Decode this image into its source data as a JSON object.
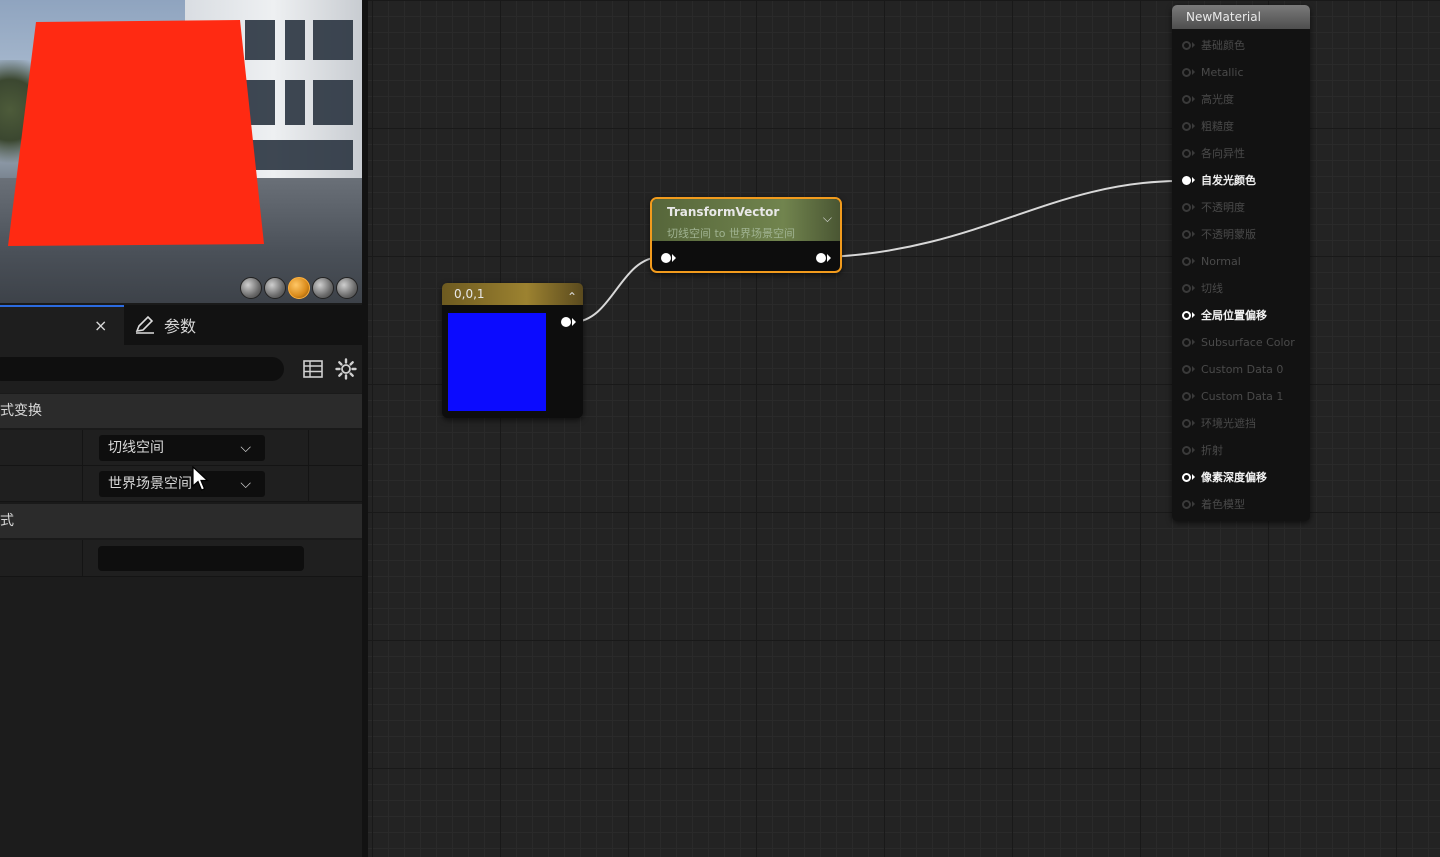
{
  "preview": {
    "toolbar_icons": [
      "cylinder-icon",
      "sphere-icon",
      "plane-icon",
      "cube-icon",
      "teapot-icon"
    ],
    "active_icon": "plane-icon",
    "preview_color": "#ff2a12"
  },
  "details": {
    "tab_close": "×",
    "params_tab_label": "参数",
    "search_value": "",
    "section_transform": "式变换",
    "source_dropdown": "切线空间",
    "dest_dropdown": "世界场景空间",
    "section_second": "式"
  },
  "nodes": {
    "constant": {
      "title": "0,0,1",
      "color": "#0b0bff"
    },
    "transform": {
      "title": "TransformVector",
      "subtitle": "切线空间 to 世界场景空间"
    },
    "material": {
      "title": "NewMaterial",
      "pins": [
        {
          "label": "基础颜色",
          "active": false,
          "filled": false
        },
        {
          "label": "Metallic",
          "active": false,
          "filled": false
        },
        {
          "label": "高光度",
          "active": false,
          "filled": false
        },
        {
          "label": "粗糙度",
          "active": false,
          "filled": false
        },
        {
          "label": "各向异性",
          "active": false,
          "filled": false
        },
        {
          "label": "自发光颜色",
          "active": true,
          "filled": true
        },
        {
          "label": "不透明度",
          "active": false,
          "filled": false
        },
        {
          "label": "不透明蒙版",
          "active": false,
          "filled": false
        },
        {
          "label": "Normal",
          "active": false,
          "filled": false
        },
        {
          "label": "切线",
          "active": false,
          "filled": false
        },
        {
          "label": "全局位置偏移",
          "active": true,
          "filled": false
        },
        {
          "label": "Subsurface Color",
          "active": false,
          "filled": false
        },
        {
          "label": "Custom Data 0",
          "active": false,
          "filled": false
        },
        {
          "label": "Custom Data 1",
          "active": false,
          "filled": false
        },
        {
          "label": "环境光遮挡",
          "active": false,
          "filled": false
        },
        {
          "label": "折射",
          "active": false,
          "filled": false
        },
        {
          "label": "像素深度偏移",
          "active": true,
          "filled": false
        },
        {
          "label": "着色模型",
          "active": false,
          "filled": false
        }
      ]
    }
  },
  "colors": {
    "selection_outline": "#f29b1d",
    "tab_accent": "#2c6be0"
  }
}
